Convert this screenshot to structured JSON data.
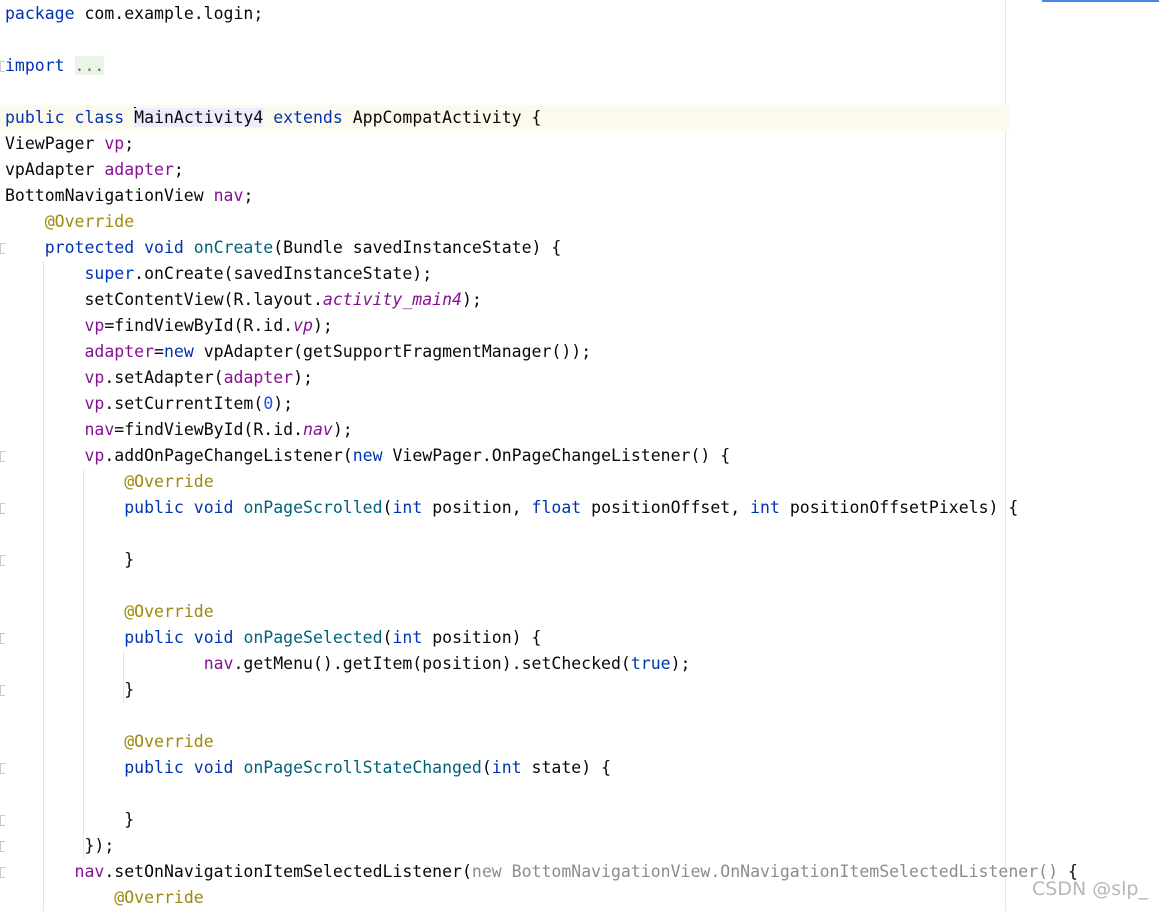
{
  "code_lines": [
    [
      {
        "t": "kw",
        "v": "package"
      },
      {
        "t": "p",
        "v": " com.example.login;"
      }
    ],
    [],
    [
      {
        "t": "kw",
        "v": "import"
      },
      {
        "t": "p",
        "v": " "
      },
      {
        "t": "fold",
        "v": "..."
      }
    ],
    [],
    [
      {
        "t": "kw",
        "v": "public class"
      },
      {
        "t": "p",
        "v": " "
      },
      {
        "t": "caret",
        "v": ""
      },
      {
        "t": "cls-hl",
        "v": "MainActivity4"
      },
      {
        "t": "p",
        "v": " "
      },
      {
        "t": "kw",
        "v": "extends"
      },
      {
        "t": "p",
        "v": " AppCompatActivity {"
      }
    ],
    [
      {
        "t": "p",
        "v": "ViewPager "
      },
      {
        "t": "fld",
        "v": "vp"
      },
      {
        "t": "p",
        "v": ";"
      }
    ],
    [
      {
        "t": "p",
        "v": "vpAdapter "
      },
      {
        "t": "fld",
        "v": "adapter"
      },
      {
        "t": "p",
        "v": ";"
      }
    ],
    [
      {
        "t": "p",
        "v": "BottomNavigationView "
      },
      {
        "t": "fld",
        "v": "nav"
      },
      {
        "t": "p",
        "v": ";"
      }
    ],
    [
      {
        "t": "p",
        "v": "    "
      },
      {
        "t": "ann",
        "v": "@Override"
      }
    ],
    [
      {
        "t": "p",
        "v": "    "
      },
      {
        "t": "kw",
        "v": "protected void"
      },
      {
        "t": "p",
        "v": " "
      },
      {
        "t": "mth",
        "v": "onCreate"
      },
      {
        "t": "p",
        "v": "(Bundle savedInstanceState) {"
      }
    ],
    [
      {
        "t": "p",
        "v": "        "
      },
      {
        "t": "kw",
        "v": "super"
      },
      {
        "t": "p",
        "v": ".onCreate(savedInstanceState);"
      }
    ],
    [
      {
        "t": "p",
        "v": "        setContentView(R.layout."
      },
      {
        "t": "ifld",
        "v": "activity_main4"
      },
      {
        "t": "p",
        "v": ");"
      }
    ],
    [
      {
        "t": "p",
        "v": "        "
      },
      {
        "t": "fld",
        "v": "vp"
      },
      {
        "t": "p",
        "v": "=findViewById(R.id."
      },
      {
        "t": "ifld",
        "v": "vp"
      },
      {
        "t": "p",
        "v": ");"
      }
    ],
    [
      {
        "t": "p",
        "v": "        "
      },
      {
        "t": "fld",
        "v": "adapter"
      },
      {
        "t": "p",
        "v": "="
      },
      {
        "t": "kw",
        "v": "new"
      },
      {
        "t": "p",
        "v": " vpAdapter(getSupportFragmentManager());"
      }
    ],
    [
      {
        "t": "p",
        "v": "        "
      },
      {
        "t": "fld",
        "v": "vp"
      },
      {
        "t": "p",
        "v": ".setAdapter("
      },
      {
        "t": "fld",
        "v": "adapter"
      },
      {
        "t": "p",
        "v": ");"
      }
    ],
    [
      {
        "t": "p",
        "v": "        "
      },
      {
        "t": "fld",
        "v": "vp"
      },
      {
        "t": "p",
        "v": ".setCurrentItem("
      },
      {
        "t": "num",
        "v": "0"
      },
      {
        "t": "p",
        "v": ");"
      }
    ],
    [
      {
        "t": "p",
        "v": "        "
      },
      {
        "t": "fld",
        "v": "nav"
      },
      {
        "t": "p",
        "v": "=findViewById(R.id."
      },
      {
        "t": "ifld",
        "v": "nav"
      },
      {
        "t": "p",
        "v": ");"
      }
    ],
    [
      {
        "t": "p",
        "v": "        "
      },
      {
        "t": "fld",
        "v": "vp"
      },
      {
        "t": "p",
        "v": ".addOnPageChangeListener("
      },
      {
        "t": "kw",
        "v": "new"
      },
      {
        "t": "p",
        "v": " ViewPager.OnPageChangeListener() {"
      }
    ],
    [
      {
        "t": "p",
        "v": "            "
      },
      {
        "t": "ann",
        "v": "@Override"
      }
    ],
    [
      {
        "t": "p",
        "v": "            "
      },
      {
        "t": "kw",
        "v": "public void"
      },
      {
        "t": "p",
        "v": " "
      },
      {
        "t": "mth",
        "v": "onPageScrolled"
      },
      {
        "t": "p",
        "v": "("
      },
      {
        "t": "kw",
        "v": "int"
      },
      {
        "t": "p",
        "v": " position, "
      },
      {
        "t": "kw",
        "v": "float"
      },
      {
        "t": "p",
        "v": " positionOffset, "
      },
      {
        "t": "kw",
        "v": "int"
      },
      {
        "t": "p",
        "v": " positionOffsetPixels) {"
      }
    ],
    [],
    [
      {
        "t": "p",
        "v": "            }"
      }
    ],
    [],
    [
      {
        "t": "p",
        "v": "            "
      },
      {
        "t": "ann",
        "v": "@Override"
      }
    ],
    [
      {
        "t": "p",
        "v": "            "
      },
      {
        "t": "kw",
        "v": "public void"
      },
      {
        "t": "p",
        "v": " "
      },
      {
        "t": "mth",
        "v": "onPageSelected"
      },
      {
        "t": "p",
        "v": "("
      },
      {
        "t": "kw",
        "v": "int"
      },
      {
        "t": "p",
        "v": " position) {"
      }
    ],
    [
      {
        "t": "p",
        "v": "                    "
      },
      {
        "t": "fld",
        "v": "nav"
      },
      {
        "t": "p",
        "v": ".getMenu().getItem(position).setChecked("
      },
      {
        "t": "kw",
        "v": "true"
      },
      {
        "t": "p",
        "v": ");"
      }
    ],
    [
      {
        "t": "p",
        "v": "            }"
      }
    ],
    [],
    [
      {
        "t": "p",
        "v": "            "
      },
      {
        "t": "ann",
        "v": "@Override"
      }
    ],
    [
      {
        "t": "p",
        "v": "            "
      },
      {
        "t": "kw",
        "v": "public void"
      },
      {
        "t": "p",
        "v": " "
      },
      {
        "t": "mth",
        "v": "onPageScrollStateChanged"
      },
      {
        "t": "p",
        "v": "("
      },
      {
        "t": "kw",
        "v": "int"
      },
      {
        "t": "p",
        "v": " state) {"
      }
    ],
    [],
    [
      {
        "t": "p",
        "v": "            }"
      }
    ],
    [
      {
        "t": "p",
        "v": "        });"
      }
    ],
    [
      {
        "t": "p",
        "v": "       "
      },
      {
        "t": "fld",
        "v": "nav"
      },
      {
        "t": "p",
        "v": ".setOnNavigationItemSelectedListener("
      },
      {
        "t": "gray",
        "v": "new BottomNavigationView.OnNavigationItemSelectedListener()"
      },
      {
        "t": "p",
        "v": " {"
      }
    ],
    [
      {
        "t": "p",
        "v": "           "
      },
      {
        "t": "ann",
        "v": "@Override"
      }
    ]
  ],
  "watermark": "CSDN @slp_",
  "colors": {
    "keyword": "#0033b3",
    "field": "#871094",
    "annotation": "#9e880d",
    "method": "#00627a",
    "number": "#1750eb",
    "current_line": "#fcfaed"
  }
}
